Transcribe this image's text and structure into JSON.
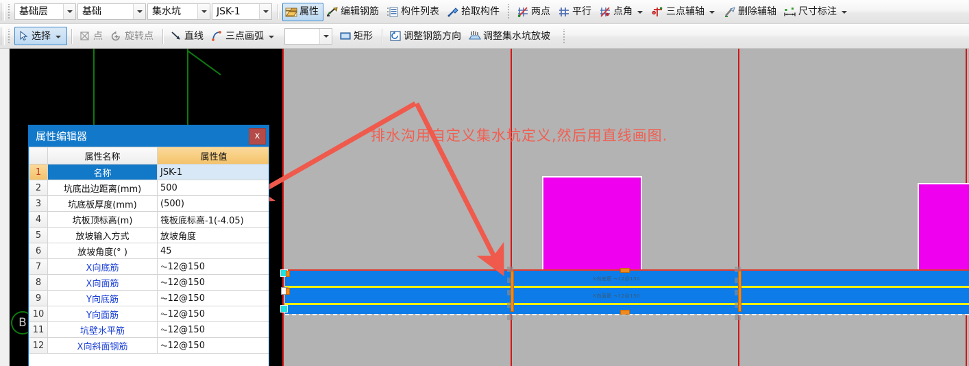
{
  "toolbar_top": {
    "combos": [
      {
        "name": "floor-combo",
        "value": "基础层"
      },
      {
        "name": "category-combo",
        "value": "基础"
      },
      {
        "name": "component-type-combo",
        "value": "集水坑"
      },
      {
        "name": "component-name-combo",
        "value": "JSK-1"
      }
    ],
    "items": [
      {
        "name": "properties-button",
        "label": "属性",
        "icon": "properties-icon",
        "active": true,
        "caret": false
      },
      {
        "name": "edit-rebar-button",
        "label": "编辑钢筋",
        "icon": "edit-rebar-icon",
        "active": false,
        "caret": false
      },
      {
        "name": "component-list-button",
        "label": "构件列表",
        "icon": "component-list-icon",
        "active": false,
        "caret": false
      },
      {
        "name": "pick-component-button",
        "label": "拾取构件",
        "icon": "eyedropper-icon",
        "active": false,
        "caret": false
      },
      {
        "name": "two-point-axis-button",
        "label": "两点",
        "icon": "two-point-axis-icon",
        "active": false,
        "caret": false
      },
      {
        "name": "parallel-axis-button",
        "label": "平行",
        "icon": "parallel-axis-icon",
        "active": false,
        "caret": false
      },
      {
        "name": "point-angle-axis-button",
        "label": "点角",
        "icon": "point-angle-axis-icon",
        "active": false,
        "caret": true
      },
      {
        "name": "three-point-axis-button",
        "label": "三点辅轴",
        "icon": "three-point-axis-icon",
        "active": false,
        "caret": true
      },
      {
        "name": "delete-aux-axis-button",
        "label": "删除辅轴",
        "icon": "delete-axis-icon",
        "active": false,
        "caret": false
      },
      {
        "name": "dimension-button",
        "label": "尺寸标注",
        "icon": "dimension-icon",
        "active": false,
        "caret": true
      }
    ]
  },
  "toolbar_second": {
    "items": [
      {
        "name": "select-button",
        "label": "选择",
        "icon": "cursor-icon",
        "active": true,
        "caret": true
      },
      {
        "name": "point-button",
        "label": "点",
        "icon": "point-icon",
        "active": false,
        "caret": false
      },
      {
        "name": "rotate-point-button",
        "label": "旋转点",
        "icon": "rotate-point-icon",
        "active": false,
        "caret": false
      },
      {
        "name": "line-button",
        "label": "直线",
        "icon": "line-icon",
        "active": false,
        "caret": false
      },
      {
        "name": "three-point-arc-button",
        "label": "三点画弧",
        "icon": "arc-icon",
        "active": false,
        "caret": true
      },
      {
        "name": "rectangle-button",
        "label": "矩形",
        "icon": "rectangle-icon",
        "active": false,
        "caret": false
      },
      {
        "name": "adjust-rebar-direction-button",
        "label": "调整钢筋方向",
        "icon": "adjust-rebar-icon",
        "active": false,
        "caret": false
      },
      {
        "name": "adjust-pit-slope-button",
        "label": "调整集水坑放坡",
        "icon": "adjust-slope-icon",
        "active": false,
        "caret": false
      }
    ]
  },
  "property_editor": {
    "title": "属性编辑器",
    "close_label": "x",
    "headers": {
      "index": "",
      "name": "属性名称",
      "value": "属性值"
    },
    "rows": [
      {
        "index": "1",
        "name": "名称",
        "value": "JSK-1",
        "selected": true,
        "blue_name": false
      },
      {
        "index": "2",
        "name": "坑底出边距离(mm)",
        "value": "500",
        "selected": false,
        "blue_name": false
      },
      {
        "index": "3",
        "name": "坑底板厚度(mm)",
        "value": "(500)",
        "selected": false,
        "blue_name": false
      },
      {
        "index": "4",
        "name": "坑板顶标高(m)",
        "value": "筏板底标高-1(-4.05)",
        "selected": false,
        "blue_name": false
      },
      {
        "index": "5",
        "name": "放坡输入方式",
        "value": "放坡角度",
        "selected": false,
        "blue_name": false
      },
      {
        "index": "6",
        "name": "放坡角度(° )",
        "value": "45",
        "selected": false,
        "blue_name": false
      },
      {
        "index": "7",
        "name": "X向底筋",
        "value": "⏦12@150",
        "selected": false,
        "blue_name": true
      },
      {
        "index": "8",
        "name": "X向面筋",
        "value": "⏦12@150",
        "selected": false,
        "blue_name": true
      },
      {
        "index": "9",
        "name": "Y向底筋",
        "value": "⏦12@150",
        "selected": false,
        "blue_name": true
      },
      {
        "index": "10",
        "name": "Y向面筋",
        "value": "⏦12@150",
        "selected": false,
        "blue_name": true
      },
      {
        "index": "11",
        "name": "坑壁水平筋",
        "value": "⏦12@150",
        "selected": false,
        "blue_name": true
      },
      {
        "index": "12",
        "name": "X向斜面钢筋",
        "value": "⏦12@150",
        "selected": false,
        "blue_name": true
      }
    ]
  },
  "canvas": {
    "annotation_text": "排水沟用自定义集水坑定义,然后用直线画图.",
    "axis_bubble_label": "B",
    "band_labels": [
      "X向底筋 ⏦12@150",
      "X向面筋 ⏦12@150"
    ]
  },
  "colors": {
    "accent": "#1279ca",
    "annotation_red": "#f15f52",
    "band_blue": "#0d7ce8",
    "magenta": "#ef00ef",
    "axis_green": "#0e7a0e",
    "grid_red": "#d81414",
    "header_orange": "#f3c269"
  }
}
